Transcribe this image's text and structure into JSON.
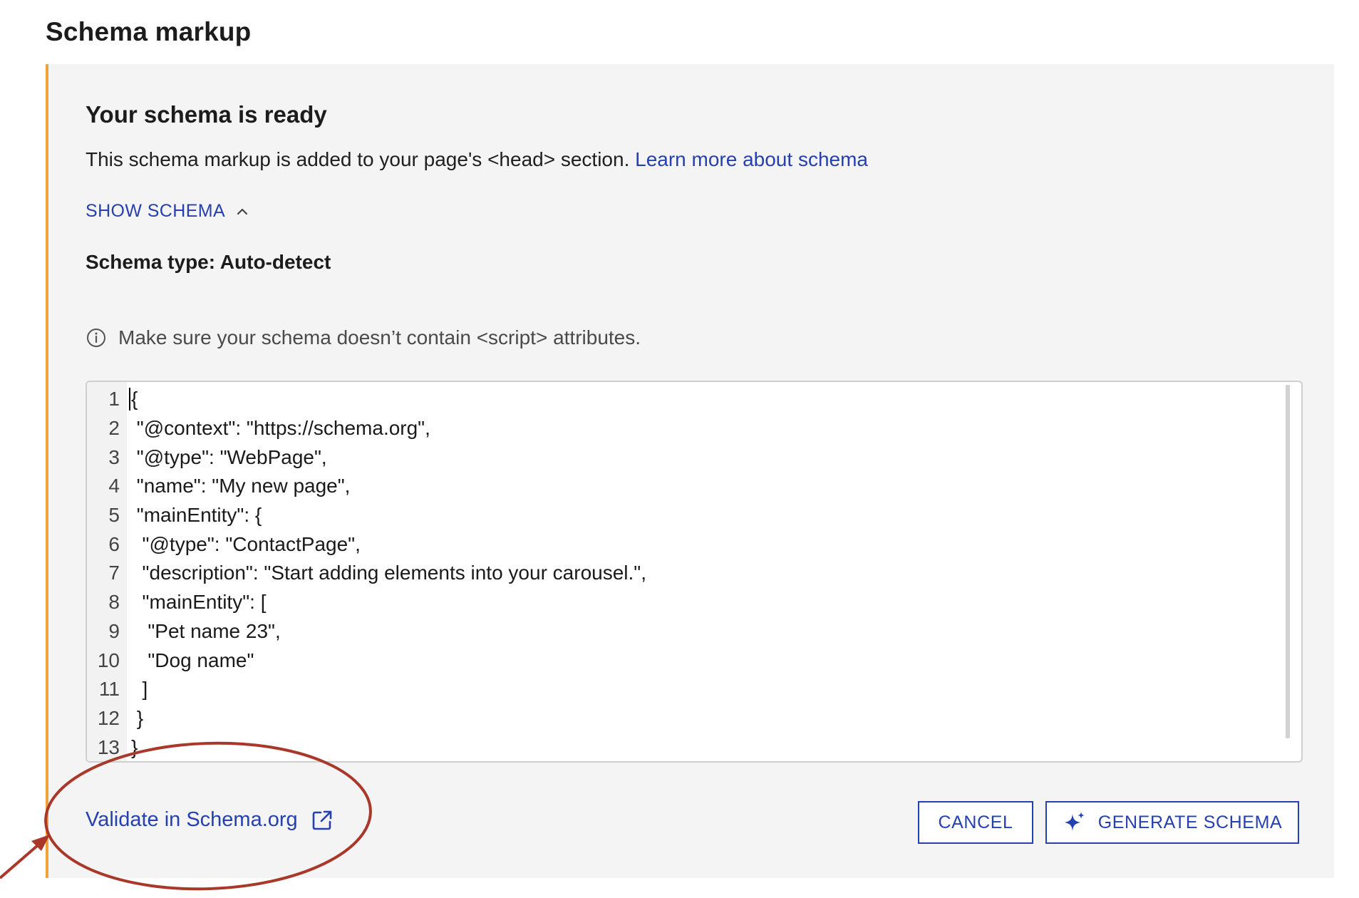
{
  "page": {
    "heading": "Schema markup"
  },
  "panel": {
    "title": "Your schema is ready",
    "description": "This schema markup is added to your page's <head> section.",
    "learn_more_link": "Learn more about schema",
    "show_schema_label": "SHOW SCHEMA",
    "schema_type_label": "Schema type: Auto-detect",
    "info_text": "Make sure your schema doesn’t contain <script> attributes.",
    "accent_color": "#f0a23a"
  },
  "editor": {
    "lines": [
      {
        "no": "1",
        "text": "{"
      },
      {
        "no": "2",
        "text": " \"@context\": \"https://schema.org\","
      },
      {
        "no": "3",
        "text": " \"@type\": \"WebPage\","
      },
      {
        "no": "4",
        "text": " \"name\": \"My new page\","
      },
      {
        "no": "5",
        "text": " \"mainEntity\": {"
      },
      {
        "no": "6",
        "text": "  \"@type\": \"ContactPage\","
      },
      {
        "no": "7",
        "text": "  \"description\": \"Start adding elements into your carousel.\","
      },
      {
        "no": "8",
        "text": "  \"mainEntity\": ["
      },
      {
        "no": "9",
        "text": "   \"Pet name 23\","
      },
      {
        "no": "10",
        "text": "   \"Dog name\""
      },
      {
        "no": "11",
        "text": "  ]"
      },
      {
        "no": "12",
        "text": " }"
      },
      {
        "no": "13",
        "text": "}"
      }
    ]
  },
  "footer": {
    "validate_link": "Validate in Schema.org",
    "cancel_label": "CANCEL",
    "generate_label": "GENERATE SCHEMA",
    "link_color": "#2540b0"
  },
  "annotation": {
    "color": "#a9382a"
  },
  "icons": {
    "chevron": "chevron-up-icon",
    "info": "info-icon",
    "external": "external-link-icon",
    "sparkle": "sparkle-icon"
  }
}
